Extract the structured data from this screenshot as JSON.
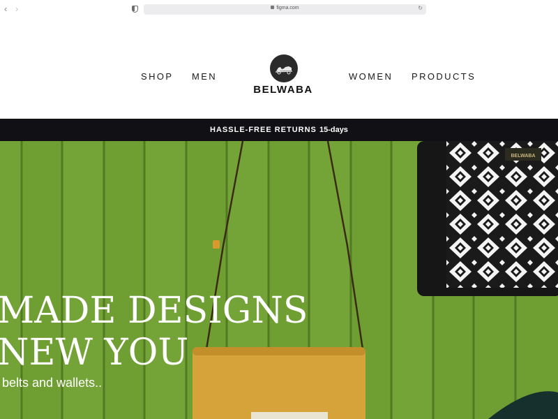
{
  "browser": {
    "back_icon": "chevron-left-icon",
    "forward_icon": "chevron-right-icon",
    "url": "figma.com"
  },
  "nav": {
    "shop": "SHOP",
    "men": "MEN",
    "women": "WOMEN",
    "products": "PRODUCTS"
  },
  "logo": {
    "text": "BELWABA"
  },
  "announcement": {
    "text": "HASSLE-FREE RETURNS",
    "days": "15-days"
  },
  "hero": {
    "title_line1": "MADE DESIGNS",
    "title_line2": "NEW YOU",
    "subtitle": "belts and wallets..",
    "bag_label": "BELWABA"
  },
  "colors": {
    "hero_green": "#6f9e33",
    "announce_bg": "#111015",
    "bag_mustard": "#d6a23a"
  }
}
